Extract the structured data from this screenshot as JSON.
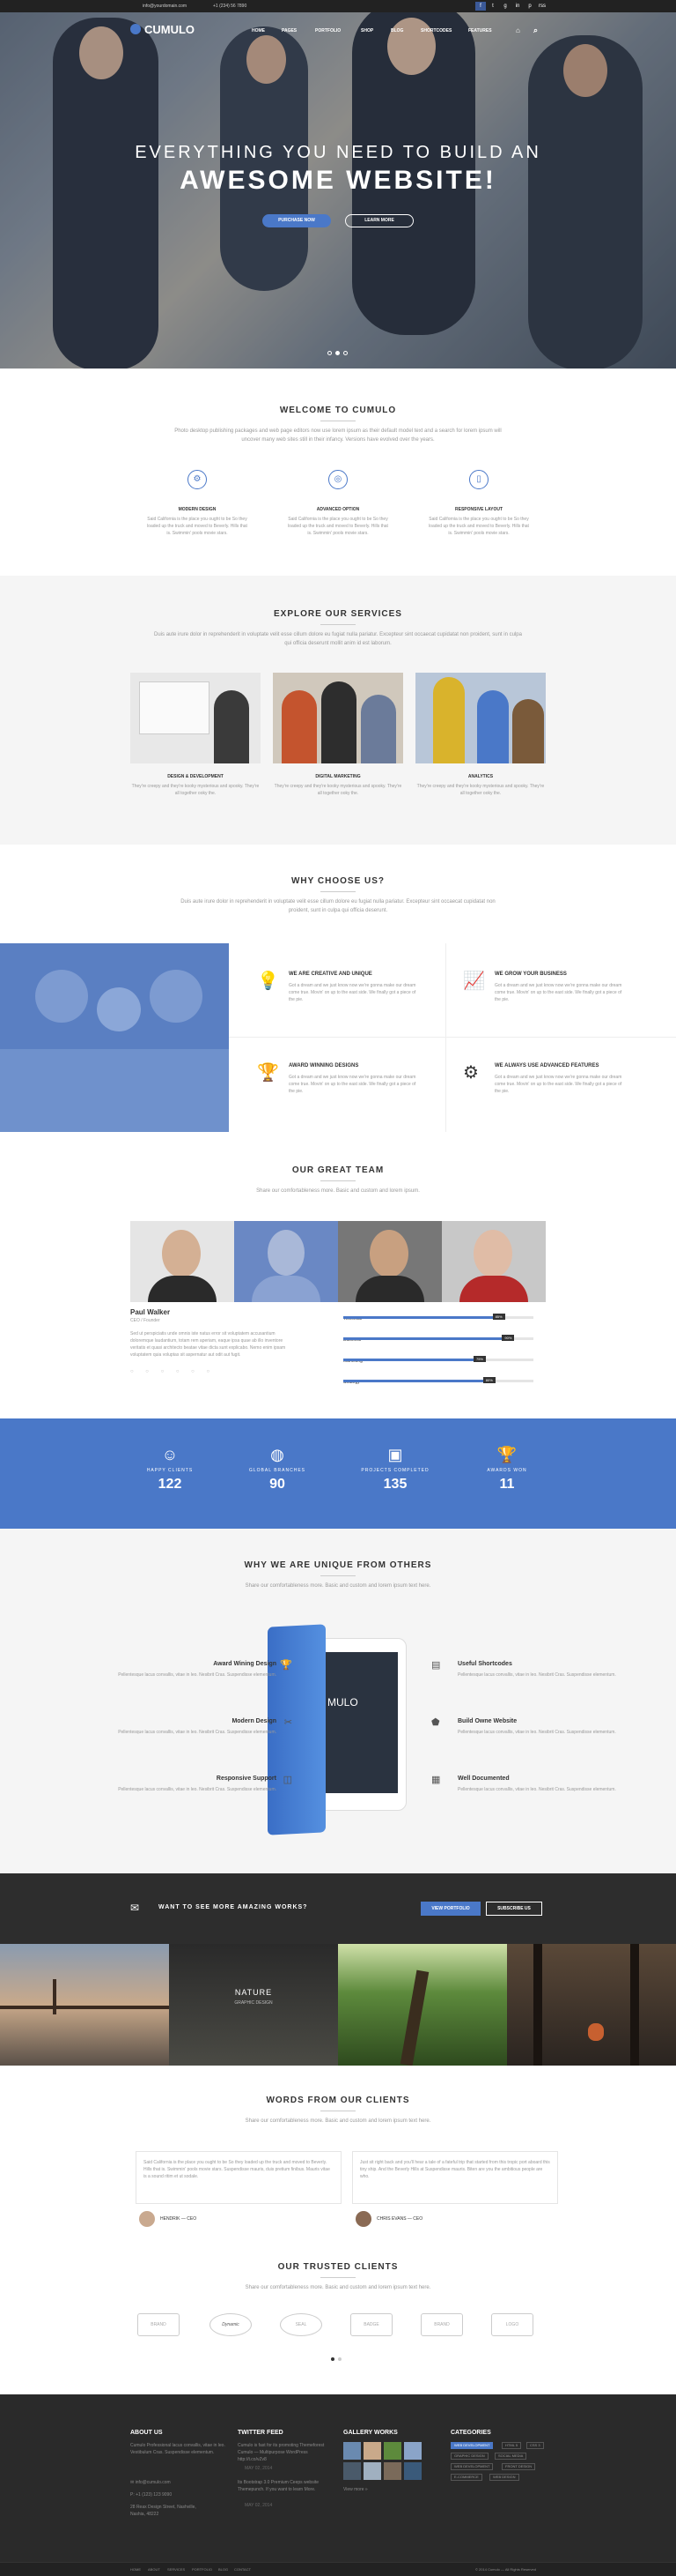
{
  "topbar": {
    "email": "info@yourdomain.com",
    "phone": "+1 (234) 56 7890",
    "social": [
      "f",
      "t",
      "g",
      "in",
      "p",
      "rss"
    ]
  },
  "nav": {
    "logo": "CUMULO",
    "items": [
      "HOME",
      "PAGES",
      "PORTFOLIO",
      "SHOP",
      "BLOG",
      "SHORTCODES",
      "FEATURES"
    ]
  },
  "hero": {
    "line1": "EVERYTHING YOU NEED TO BUILD AN",
    "line2": "AWESOME WEBSITE!",
    "btn_primary": "PURCHASE NOW",
    "btn_secondary": "LEARN MORE"
  },
  "welcome": {
    "title": "WELCOME TO CUMULO",
    "subtitle": "Photo desktop publishing packages and web page editors now use lorem ipsum as their default model text and a search for lorem ipsum will uncover many web sites still in their infancy. Versions have evolved over the years.",
    "features": [
      {
        "icon": "⚙",
        "title": "MODERN DESIGN",
        "text": "Said California is the place you ought to be So they loaded up the truck and moved to Beverly. Hills that is. Swimmin' pools movie stars."
      },
      {
        "icon": "◎",
        "title": "ADVANCED OPTION",
        "text": "Said California is the place you ought to be So they loaded up the truck and moved to Beverly. Hills that is. Swimmin' pools movie stars."
      },
      {
        "icon": "▯",
        "title": "RESPONSIVE LAYOUT",
        "text": "Said California is the place you ought to be So they loaded up the truck and moved to Beverly. Hills that is. Swimmin' pools movie stars."
      }
    ]
  },
  "services": {
    "title": "EXPLORE OUR SERVICES",
    "subtitle": "Duis aute irure dolor in reprehenderit in voluptate velit esse cillum dolore eu fugiat nulla pariatur. Excepteur sint occaecat cupidatat non proident, sunt in culpa qui officia deserunt mollit anim id est laborum.",
    "items": [
      {
        "title": "DESIGN & DEVELOPMENT",
        "text": "They're creepy and they're kooky mysterious and spooky. They're all together ooky the."
      },
      {
        "title": "DIGITAL MARKETING",
        "text": "They're creepy and they're kooky mysterious and spooky. They're all together ooky the."
      },
      {
        "title": "ANALYTICS",
        "text": "They're creepy and they're kooky mysterious and spooky. They're all together ooky the."
      }
    ]
  },
  "why": {
    "title": "WHY CHOOSE US?",
    "subtitle": "Duis aute irure dolor in reprehenderit in voluptate velit esse cillum dolore eu fugiat nulla pariatur. Excepteur sint occaecat cupidatat non proident, sunt in culpa qui officia deserunt.",
    "items": [
      {
        "icon": "💡",
        "title": "WE ARE CREATIVE AND UNIQUE",
        "text": "Got a dream and we just know now we're gonna make our dream come true. Movin' on up to the east side. We finally got a piece of the pie."
      },
      {
        "icon": "📈",
        "title": "WE GROW YOUR BUSINESS",
        "text": "Got a dream and we just know now we're gonna make our dream come true. Movin' on up to the east side. We finally got a piece of the pie."
      },
      {
        "icon": "🏆",
        "title": "AWARD WINNING DESIGNS",
        "text": "Got a dream and we just know now we're gonna make our dream come true. Movin' on up to the east side. We finally got a piece of the pie."
      },
      {
        "icon": "⚙",
        "title": "WE ALWAYS USE ADVANCED FEATURES",
        "text": "Got a dream and we just know now we're gonna make our dream come true. Movin' on up to the east side. We finally got a piece of the pie."
      }
    ]
  },
  "team": {
    "title": "OUR GREAT TEAM",
    "subtitle": "Share our comfortableness more. Basic and custom and lorem ipsum.",
    "featured_name": "Paul Walker",
    "featured_role": "CEO / Founder",
    "featured_text": "Sed ut perspiciatis unde omnis iste natus error sit voluptatem accusantium doloremque laudantium, totam rem aperiam, eaque ipsa quae ab illo inventore veritatis et quasi architecto beatae vitae dicta sunt explicabo. Nemo enim ipsam voluptatem quia voluptas sit aspernatur aut odit aut fugit.",
    "skills": [
      {
        "label": "Technical",
        "value": 85
      },
      {
        "label": "Business",
        "value": 90
      },
      {
        "label": "Marketing",
        "value": 75
      },
      {
        "label": "Strategy",
        "value": 80
      }
    ]
  },
  "counters": [
    {
      "icon": "☺",
      "label": "HAPPY CLIENTS",
      "value": "122"
    },
    {
      "icon": "◍",
      "label": "GLOBAL BRANCHES",
      "value": "90"
    },
    {
      "icon": "▣",
      "label": "PROJECTS COMPLETED",
      "value": "135"
    },
    {
      "icon": "🏆",
      "label": "AWARDS WON",
      "value": "11"
    }
  ],
  "unique": {
    "title": "WHY WE ARE UNIQUE FROM OTHERS",
    "subtitle": "Share our comfortableness more. Basic and custom and lorem ipsum text here.",
    "left": [
      {
        "icon": "🏆",
        "title": "Award Wining Design",
        "text": "Pellentesque lacus convallis, vitae in leo. Nesibrit Cras. Suspendisse elementum."
      },
      {
        "icon": "✂",
        "title": "Modern Design",
        "text": "Pellentesque lacus convallis, vitae in leo. Nesibrit Cras. Suspendisse elementum."
      },
      {
        "icon": "◫",
        "title": "Responsive Support",
        "text": "Pellentesque lacus convallis, vitae in leo. Nesibrit Cras. Suspendisse elementum."
      }
    ],
    "right": [
      {
        "icon": "▤",
        "title": "Useful Shortcodes",
        "text": "Pellentesque lacus convallis, vitae in leo. Nesibrit Cras. Suspendisse elementum."
      },
      {
        "icon": "⬟",
        "title": "Build Owne Website",
        "text": "Pellentesque lacus convallis, vitae in leo. Nesibrit Cras. Suspendisse elementum."
      },
      {
        "icon": "▦",
        "title": "Well Documented",
        "text": "Pellentesque lacus convallis, vitae in leo. Nesibrit Cras. Suspendisse elementum."
      }
    ],
    "tablet_text": "MULO"
  },
  "cta": {
    "text": "WANT TO SEE MORE AMAZING WORKS?",
    "btn_primary": "VIEW PORTFOLIO",
    "btn_secondary": "SUBSCRIBE US"
  },
  "gallery": {
    "featured_title": "NATURE",
    "featured_sub": "GRAPHIC DESIGN"
  },
  "testimonials": {
    "title": "WORDS FROM OUR CLIENTS",
    "subtitle": "Share our comfortableness more. Basic and custom and lorem ipsum text here.",
    "items": [
      {
        "text": "Said California is the place you ought to be So they loaded up the truck and moved to Beverly. Hills that is. Swimmin' pools movie stars. Suspendisse mauris, duis pretium finibus. Mauris vitae is a sound ritim et ut sodale.",
        "name": "HENDRIK — CEO"
      },
      {
        "text": "Just sit right back and you'll hear a tale of a fateful trip that started from this tropic port aboard this tiny ship. And the Beverly Hills at Suspendisse mauris. Biten are you the ambitious people are who.",
        "name": "CHRIS EVANS — CEO"
      }
    ]
  },
  "clients": {
    "title": "OUR TRUSTED CLIENTS",
    "subtitle": "Share our comfortableness more. Basic and custom and lorem ipsum text here.",
    "logos": [
      "BRAND",
      "Dynamic",
      "SEAL",
      "BADGE",
      "BRAND",
      "LOGO"
    ]
  },
  "footer": {
    "about_title": "ABOUT US",
    "about_text": "Cumulo Professional lacus convallis, vitae in leo. Vestibulum Cras. Suspendisse elementum.",
    "email": "info@cumulo.com",
    "phone": "P: +1 (123) 123 9090",
    "address": "28 Reax Design Street, Nashville, Nashia, 48222",
    "twitter_title": "TWITTER FEED",
    "tweets": [
      "Cumulo is fast for its promoting Themeforest Cumulo — Multipurpose WordPress http://t.co/vZv8",
      "Its Bootstrap 3.0 Premium Ceeps website Themepunch. If you want to learn More."
    ],
    "tweet_dates": [
      "MAY 02, 2014",
      "MAY 02, 2014"
    ],
    "gallery_title": "GALLERY WORKS",
    "gallery_more": "View more »",
    "categories_title": "CATEGORIES",
    "categories": [
      "WEB DEVELOPMENT",
      "HTML 5",
      "CSS 3",
      "GRAPHIC DESIGN",
      "SOCIAL MEDIA",
      "WEB DEVELOPMENT",
      "FRONT DESIGN",
      "E-COMMERCE",
      "WEB DESIGN"
    ],
    "bottom_links": [
      "HOME",
      "ABOUT",
      "SERVICES",
      "PORTFOLIO",
      "BLOG",
      "CONTACT"
    ],
    "copyright": "© 2014 Cumulo — All Rights Reserved"
  },
  "colors": {
    "accent": "#4a78c8",
    "dark": "#2d2d2d"
  }
}
